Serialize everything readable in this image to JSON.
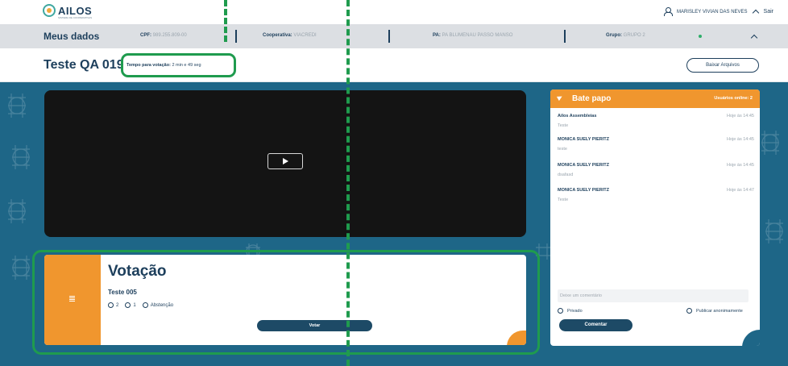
{
  "topbar": {
    "logo_text": "AILOS",
    "logo_sub": "SISTEMA DE COOPERATIVAS",
    "user_name": "MARISLEY VIVIAN DAS NEVES",
    "logout": "Sair"
  },
  "datastrip": {
    "title": "Meus dados",
    "cpf_label": "CPF:",
    "cpf_value": "989.255.809-00",
    "coop_label": "Cooperativa:",
    "coop_value": "VIACREDI",
    "pa_label": "PA:",
    "pa_value": "PA BLUMENAU PASSO MANSO",
    "group_label": "Grupo:",
    "group_value": "GRUPO 2"
  },
  "session": {
    "title": "Teste QA 019",
    "timer_label": "Tempo para votação:",
    "timer_value": "2 min e 49 seg",
    "download_label": "Baixar Arquivos"
  },
  "voting": {
    "title": "Votação",
    "question": "Teste 005",
    "options": [
      "2",
      "1",
      "Abstenção"
    ],
    "vote_button": "Votar"
  },
  "chat": {
    "title": "Bate papo",
    "online": "Usuários online: 2",
    "messages": [
      {
        "author": "Ailos Assembleias",
        "time": "Hoje às 14:45",
        "text": "Teste"
      },
      {
        "author": "MONICA SUELY PIERITZ",
        "time": "Hoje às 14:45",
        "text": "teste"
      },
      {
        "author": "MONICA SUELY PIERITZ",
        "time": "Hoje às 14:45",
        "text": "dsafasd"
      },
      {
        "author": "MONICA SUELY PIERITZ",
        "time": "Hoje às 14:47",
        "text": "Teste"
      }
    ],
    "input_placeholder": "Deixe um comentário",
    "private_label": "Privado",
    "anonymous_label": "Publicar anonimamente",
    "send_button": "Comentar"
  },
  "colors": {
    "brand_navy": "#1d3f5c",
    "accent_orange": "#f0962e",
    "background_teal": "#1e6687",
    "highlight_green": "#1f9b4e"
  }
}
